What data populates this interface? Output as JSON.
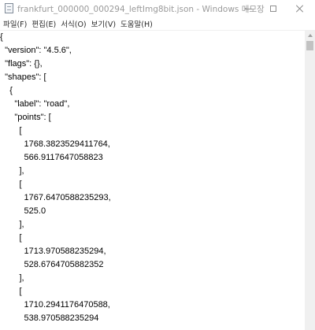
{
  "window": {
    "title": "frankfurt_000000_000294_leftImg8bit.json - Windows 메모장",
    "icon": "notepad-icon"
  },
  "menu": [
    "파일(F)",
    "편집(E)",
    "서식(O)",
    "보기(V)",
    "도움말(H)"
  ],
  "lines": [
    "{",
    "  \"version\": \"4.5.6\",",
    "  \"flags\": {},",
    "  \"shapes\": [",
    "    {",
    "      \"label\": \"road\",",
    "      \"points\": [",
    "        [",
    "          1768.3823529411764,",
    "          566.9117647058823",
    "        ],",
    "        [",
    "          1767.6470588235293,",
    "          525.0",
    "        ],",
    "        [",
    "          1713.970588235294,",
    "          528.6764705882352",
    "        ],",
    "        [",
    "          1710.2941176470588,",
    "          538.970588235294",
    "        ],"
  ]
}
